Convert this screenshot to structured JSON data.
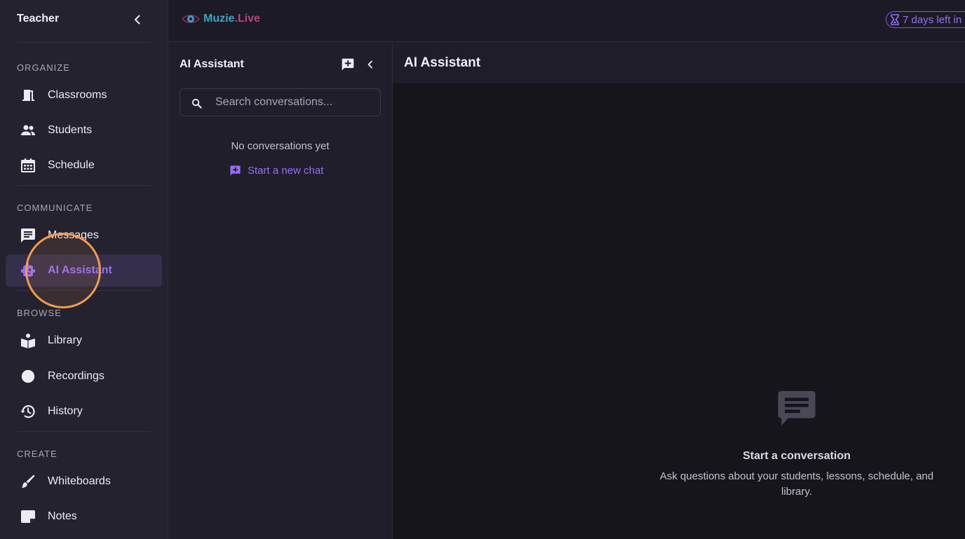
{
  "sidebar": {
    "title": "Teacher",
    "sections": {
      "organize": "ORGANIZE",
      "communicate": "COMMUNICATE",
      "browse": "BROWSE",
      "create": "CREATE"
    },
    "items": [
      {
        "label": "Classrooms",
        "icon": "door-icon"
      },
      {
        "label": "Students",
        "icon": "people-icon"
      },
      {
        "label": "Schedule",
        "icon": "calendar-icon"
      },
      {
        "label": "Messages",
        "icon": "chat-icon"
      },
      {
        "label": "AI Assistant",
        "icon": "robot-icon",
        "active": true
      },
      {
        "label": "Library",
        "icon": "book-reader-icon"
      },
      {
        "label": "Recordings",
        "icon": "record-icon"
      },
      {
        "label": "History",
        "icon": "history-icon"
      },
      {
        "label": "Whiteboards",
        "icon": "brush-icon"
      },
      {
        "label": "Notes",
        "icon": "note-icon"
      }
    ]
  },
  "topbar": {
    "logo_text_a": "Muzie",
    "logo_text_b": ".Live",
    "trial_badge": "7 days left in"
  },
  "conversations": {
    "title": "AI Assistant",
    "search_placeholder": "Search conversations...",
    "empty_text": "No conversations yet",
    "new_chat_label": "Start a new chat"
  },
  "chat": {
    "title": "AI Assistant",
    "empty_title": "Start a conversation",
    "empty_desc": "Ask questions about your students, lessons, schedule, and library."
  },
  "colors": {
    "accent": "#9b6cf6",
    "sidebar_bg": "#24222f",
    "active_bg": "#352f4b",
    "cursor_ring": "#f29a4e"
  }
}
